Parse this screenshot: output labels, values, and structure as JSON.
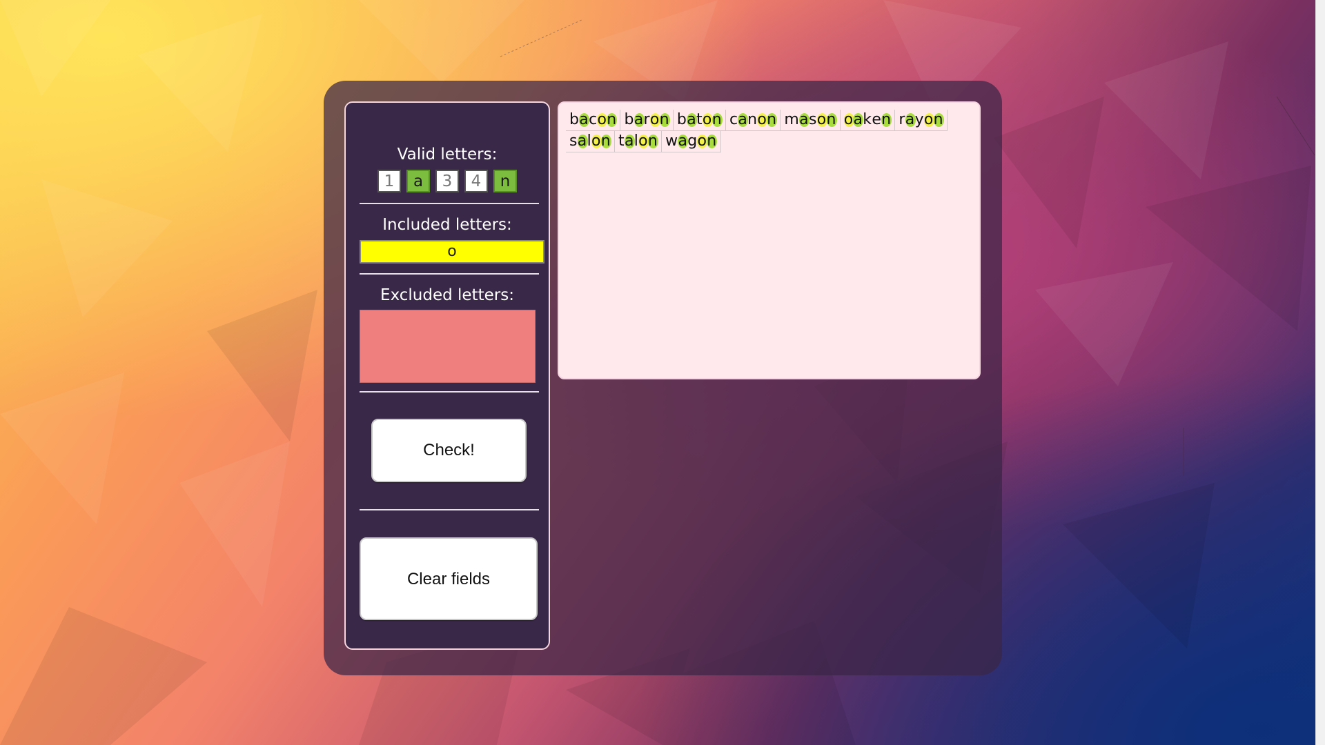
{
  "colors": {
    "valid_green": "#7cbc3e",
    "included_yellow": "#ffff00",
    "excluded_red": "#ef7f7f",
    "results_bg": "#ffe9ec",
    "panel_bg": "#3a2848"
  },
  "sidebar": {
    "valid": {
      "label": "Valid letters:",
      "slots": [
        {
          "value": "1",
          "state": "empty"
        },
        {
          "value": "a",
          "state": "green"
        },
        {
          "value": "3",
          "state": "empty"
        },
        {
          "value": "4",
          "state": "empty"
        },
        {
          "value": "n",
          "state": "green"
        }
      ]
    },
    "included": {
      "label": "Included letters:",
      "value": "o"
    },
    "excluded": {
      "label": "Excluded letters:",
      "value": ""
    },
    "check_button": "Check!",
    "clear_button": "Clear fields"
  },
  "results": {
    "words": [
      {
        "text": "bacon",
        "marks": [
          "",
          "g",
          "",
          "y",
          "g"
        ]
      },
      {
        "text": "baron",
        "marks": [
          "",
          "g",
          "",
          "y",
          "g"
        ]
      },
      {
        "text": "baton",
        "marks": [
          "",
          "g",
          "",
          "y",
          "g"
        ]
      },
      {
        "text": "canon",
        "marks": [
          "",
          "g",
          "",
          "y",
          "g"
        ]
      },
      {
        "text": "mason",
        "marks": [
          "",
          "g",
          "",
          "y",
          "g"
        ]
      },
      {
        "text": "oaken",
        "marks": [
          "y",
          "g",
          "",
          "",
          "g"
        ]
      },
      {
        "text": "rayon",
        "marks": [
          "",
          "g",
          "",
          "y",
          "g"
        ]
      },
      {
        "text": "salon",
        "marks": [
          "",
          "g",
          "",
          "y",
          "g"
        ]
      },
      {
        "text": "talon",
        "marks": [
          "",
          "g",
          "",
          "y",
          "g"
        ]
      },
      {
        "text": "wagon",
        "marks": [
          "",
          "g",
          "",
          "y",
          "g"
        ]
      }
    ]
  }
}
